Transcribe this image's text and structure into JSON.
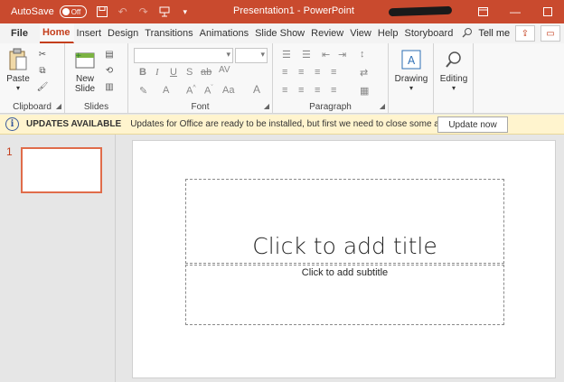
{
  "titlebar": {
    "autosave_label": "AutoSave",
    "autosave_state": "Off",
    "document_title": "Presentation1  -  PowerPoint"
  },
  "tabs": [
    {
      "label": "File"
    },
    {
      "label": "Home"
    },
    {
      "label": "Insert"
    },
    {
      "label": "Design"
    },
    {
      "label": "Transitions"
    },
    {
      "label": "Animations"
    },
    {
      "label": "Slide Show"
    },
    {
      "label": "Review"
    },
    {
      "label": "View"
    },
    {
      "label": "Help"
    },
    {
      "label": "Storyboard"
    }
  ],
  "tell_me": "Tell me",
  "ribbon": {
    "clipboard": {
      "label": "Clipboard",
      "paste": "Paste"
    },
    "slides": {
      "label": "Slides",
      "new_slide_line1": "New",
      "new_slide_line2": "Slide"
    },
    "font": {
      "label": "Font"
    },
    "paragraph": {
      "label": "Paragraph"
    },
    "drawing": {
      "label": "Drawing"
    },
    "editing": {
      "label": "Editing"
    }
  },
  "infobar": {
    "title": "UPDATES AVAILABLE",
    "message": "Updates for Office are ready to be installed, but first we need to close some apps.",
    "button": "Update now"
  },
  "thumbnails": [
    {
      "number": "1"
    }
  ],
  "slide": {
    "title_placeholder": "Click to add title",
    "subtitle_placeholder": "Click to add subtitle"
  },
  "colors": {
    "accent": "#c43e1c",
    "titlebar": "#c94a2e",
    "infobar": "#fff4ce"
  }
}
